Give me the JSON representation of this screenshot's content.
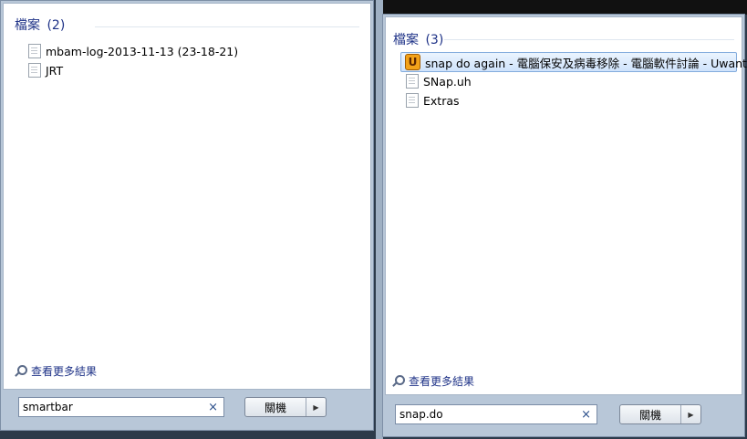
{
  "left_panel": {
    "section_title": "檔案",
    "section_count": "(2)",
    "items": [
      {
        "label": "mbam-log-2013-11-13 (23-18-21)",
        "icon": "text-file-icon",
        "selected": false
      },
      {
        "label": "JRT",
        "icon": "text-file-icon",
        "selected": false
      }
    ],
    "see_more": "查看更多結果",
    "search_value": "smartbar",
    "clear_glyph": "×",
    "shutdown_label": "關機",
    "shutdown_arrow": "▶"
  },
  "right_panel": {
    "section_title": "檔案",
    "section_count": "(3)",
    "items": [
      {
        "label": "snap do again - 電腦保安及病毒移除 - 電腦軟件討論 - Uwants",
        "icon": "uwants-icon",
        "icon_glyph": "U",
        "selected": true
      },
      {
        "label": "SNap.uh",
        "icon": "text-file-icon",
        "selected": false
      },
      {
        "label": "Extras",
        "icon": "text-file-icon",
        "selected": false
      }
    ],
    "see_more": "查看更多結果",
    "search_value": "snap.do",
    "clear_glyph": "×",
    "shutdown_label": "關機",
    "shutdown_arrow": "▶"
  },
  "colors": {
    "accent": "#1e3287",
    "selection": "#cfe3fb",
    "panel_frame": "#b8c7d8"
  }
}
